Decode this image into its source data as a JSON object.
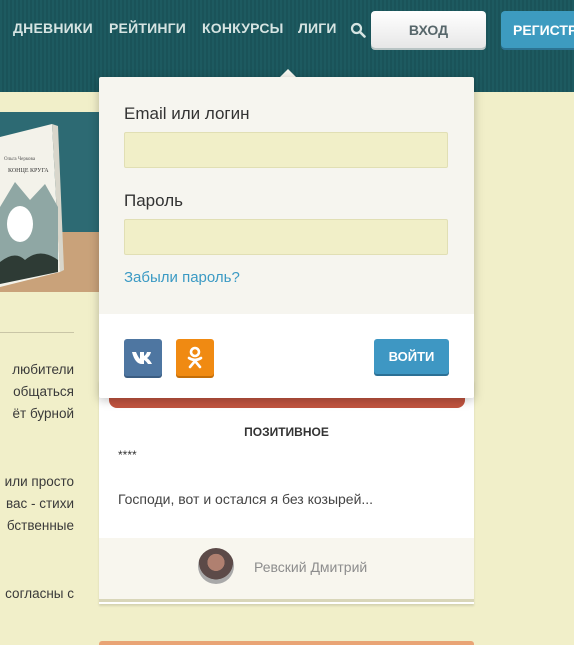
{
  "nav": {
    "items": [
      "ДНЕВНИКИ",
      "РЕЙТИНГИ",
      "КОНКУРСЫ",
      "ЛИГИ"
    ],
    "search_icon": "search-icon",
    "login_label": "ВХОД",
    "register_label": "РЕГИСТРА"
  },
  "book": {
    "author": "Ольга Черкова",
    "title": "КОНЦЕ КРУГА"
  },
  "left_text": {
    "paragraph1": [
      "любители",
      "общаться",
      "ёт бурной"
    ],
    "paragraph2": [
      "или просто",
      "вас - стихи",
      "бственные"
    ],
    "paragraph3": [
      "согласны с"
    ]
  },
  "login_popup": {
    "email_label": "Email или логин",
    "email_value": "",
    "password_label": "Пароль",
    "password_value": "",
    "forgot_label": "Забыли пароль?",
    "submit_label": "ВОЙТИ",
    "social": [
      "vk-icon",
      "ok-icon"
    ]
  },
  "card": {
    "title": "ПОЗИТИВНОЕ",
    "stars": "****",
    "excerpt": "Господи, вот и остался я без козырей...",
    "author_name": "Ревский Дмитрий"
  },
  "colors": {
    "header_bg": "#1d5a60",
    "page_bg": "#f1efc9",
    "accent_blue": "#3e97c3",
    "vk_blue": "#4e76a1",
    "ok_orange": "#f08a12",
    "card_red": "#c0533f"
  }
}
